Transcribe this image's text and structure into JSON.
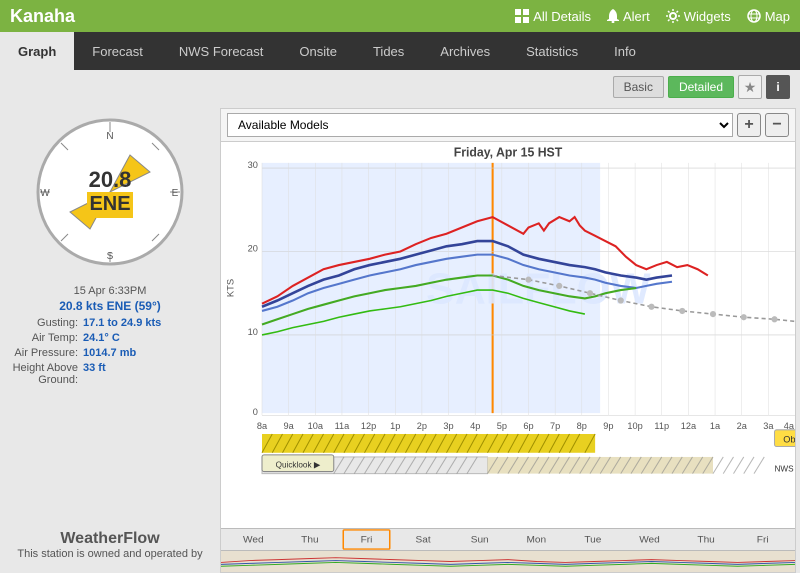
{
  "header": {
    "title": "Kanaha",
    "nav_items": [
      {
        "label": "All Details",
        "icon": "grid-icon"
      },
      {
        "label": "Alert",
        "icon": "bell-icon"
      },
      {
        "label": "Widgets",
        "icon": "gear-icon"
      },
      {
        "label": "Map",
        "icon": "map-icon"
      }
    ]
  },
  "tabs": [
    {
      "label": "Graph",
      "active": true
    },
    {
      "label": "Forecast",
      "active": false
    },
    {
      "label": "NWS Forecast",
      "active": false
    },
    {
      "label": "Onsite",
      "active": false
    },
    {
      "label": "Tides",
      "active": false
    },
    {
      "label": "Archives",
      "active": false
    },
    {
      "label": "Statistics",
      "active": false
    },
    {
      "label": "Info",
      "active": false
    }
  ],
  "view_toggle": {
    "basic_label": "Basic",
    "detailed_label": "Detailed"
  },
  "models": {
    "label": "Available Models",
    "plus": "+",
    "minus": "−"
  },
  "chart": {
    "title": "Friday, Apr 15 HST",
    "watermark": "SAILFLOW",
    "y_axis_label": "KTS",
    "y_labels": [
      "30",
      "20",
      "10",
      "0"
    ],
    "x_labels": [
      "8a",
      "9a",
      "10a",
      "11a",
      "12p",
      "1p",
      "2p",
      "3p",
      "4p",
      "5p",
      "6p",
      "7p",
      "8p",
      "9p",
      "10p",
      "11p",
      "12a",
      "1a",
      "2a",
      "3a",
      "4a"
    ],
    "observed_label": "Observed",
    "quicklook_label": "Quicklook",
    "nws_label": "NWS Mar"
  },
  "compass": {
    "speed": "20.8",
    "direction": "ENE"
  },
  "stats": {
    "date": "15 Apr 6:33PM",
    "speed": "20.8 kts ENE (59°)",
    "gusting_label": "Gusting:",
    "gusting_value": "17.1 to 24.9 kts",
    "air_temp_label": "Air Temp:",
    "air_temp_value": "24.1° C",
    "air_pressure_label": "Air Pressure:",
    "air_pressure_value": "1014.7 mb",
    "height_label": "Height Above Ground:",
    "height_value": "33 ft"
  },
  "branding": {
    "name": "WeatherFlow",
    "tagline": "This station is owned and operated by"
  },
  "timeline": {
    "labels": [
      "Wed",
      "Thu",
      "Fri",
      "Sat",
      "Sun",
      "Mon",
      "Tue",
      "Wed",
      "Thu",
      "Fri"
    ]
  }
}
